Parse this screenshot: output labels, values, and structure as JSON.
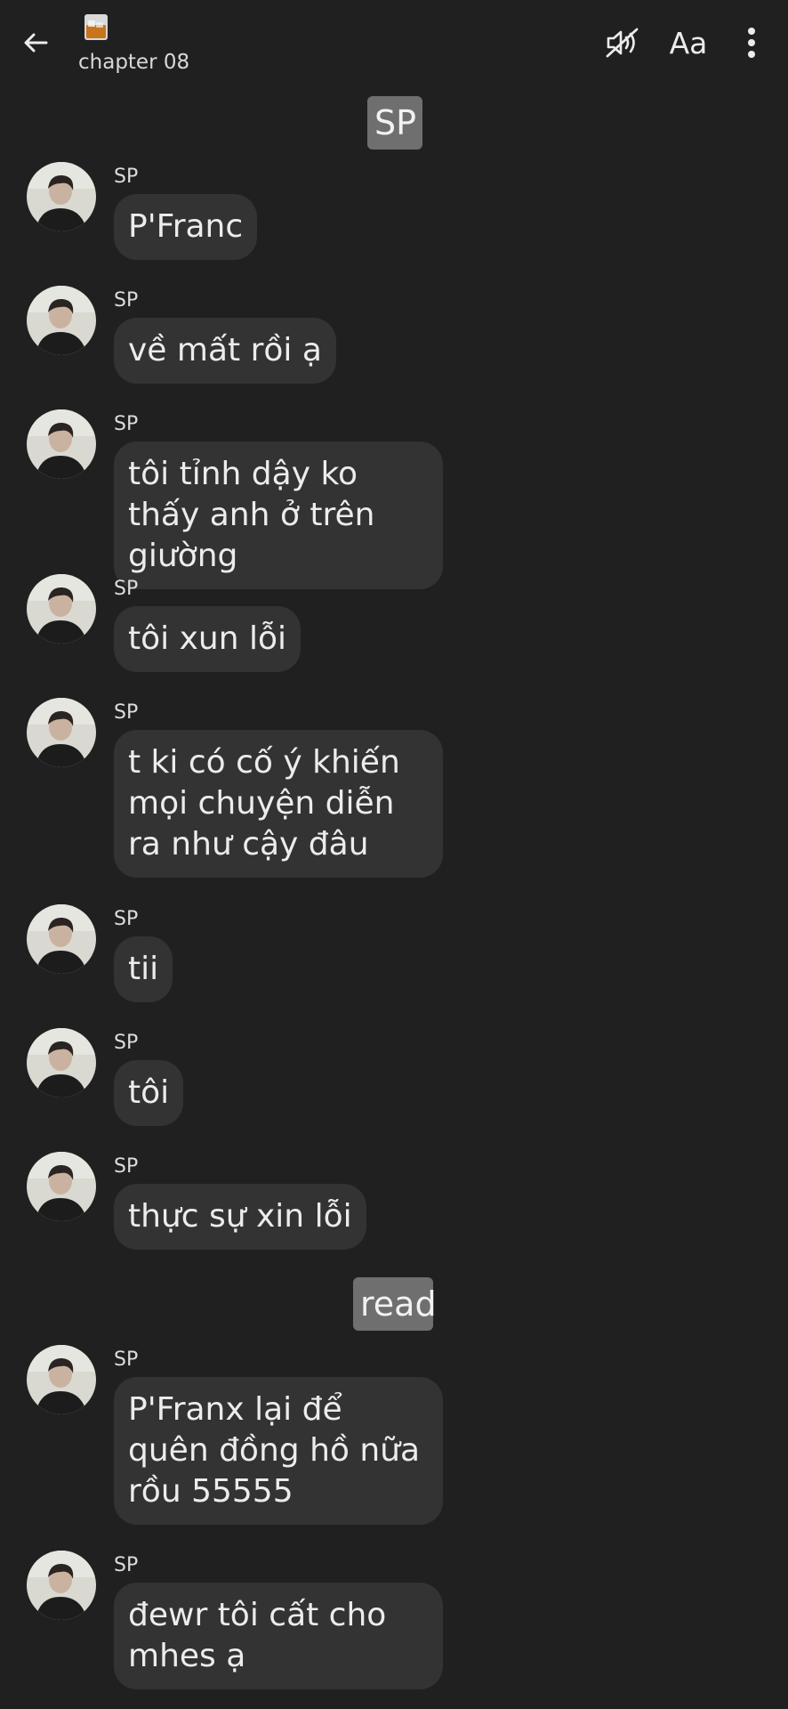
{
  "header": {
    "title": "chapter 08",
    "emoji_icon": "whiskey-glass-icon",
    "font_button": "Aa",
    "icons": [
      "back-arrow-icon",
      "mute-icon",
      "more-vert-icon"
    ]
  },
  "labels": {
    "top": "SP",
    "read": "read"
  },
  "messages": [
    {
      "sender": "SP",
      "text": "P'Franc"
    },
    {
      "sender": "SP",
      "text": "về mất rồi ạ"
    },
    {
      "sender": "SP",
      "text": "tôi tỉnh dậy ko thấy anh ở trên giường"
    },
    {
      "sender": "SP",
      "text": "tôi xun lỗi"
    },
    {
      "sender": "SP",
      "text": "t ki có cố ý khiến mọi chuyện diễn ra như cậy đâu"
    },
    {
      "sender": "SP",
      "text": "tii"
    },
    {
      "sender": "SP",
      "text": "tôi"
    },
    {
      "sender": "SP",
      "text": "thực sự xin lỗi"
    },
    {
      "sender": "SP",
      "text": "P'Franx lại để quên đồng hồ nữa rồu 55555"
    },
    {
      "sender": "SP",
      "text": "đewr tôi cất cho mhes ạ"
    }
  ],
  "colors": {
    "background": "#202020",
    "bubble": "#333333",
    "label": "#6f6f6f",
    "text": "#ececec"
  }
}
